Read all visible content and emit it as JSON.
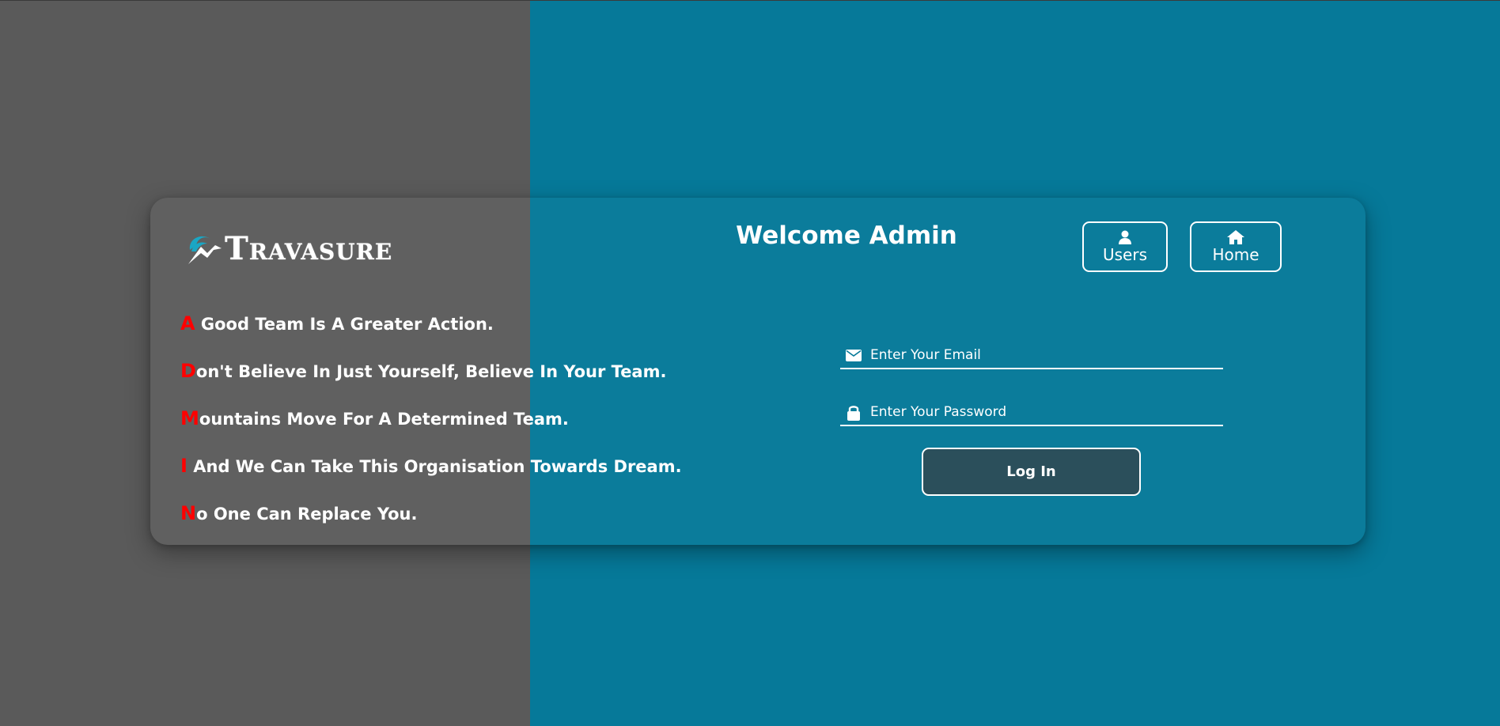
{
  "brand": {
    "name": "Travasure",
    "logo_icon": "mountain-swoosh-logo-icon"
  },
  "header": {
    "title": "Welcome Admin"
  },
  "nav": {
    "users": {
      "label": "Users",
      "icon": "user-icon"
    },
    "home": {
      "label": "Home",
      "icon": "home-icon"
    }
  },
  "quotes": [
    {
      "initial": "A",
      "rest": " Good Team Is A Greater Action."
    },
    {
      "initial": "D",
      "rest": "on't Believe In Just Yourself, Believe In Your Team."
    },
    {
      "initial": "M",
      "rest": "ountains Move For A Determined Team."
    },
    {
      "initial": "I",
      "rest": " And We Can Take This Organisation Towards Dream."
    },
    {
      "initial": "N",
      "rest": "o One Can Replace You."
    }
  ],
  "form": {
    "email": {
      "placeholder": "Enter Your Email",
      "value": "",
      "icon": "envelope-icon"
    },
    "password": {
      "placeholder": "Enter Your Password",
      "value": "",
      "icon": "lock-icon"
    },
    "submit_label": "Log In"
  },
  "colors": {
    "left_panel": "#5a5a5a",
    "right_panel": "#067999",
    "accent_initial": "#ff0000",
    "logo_teal": "#1aa6c4",
    "button_bg": "#2b4f5b"
  }
}
